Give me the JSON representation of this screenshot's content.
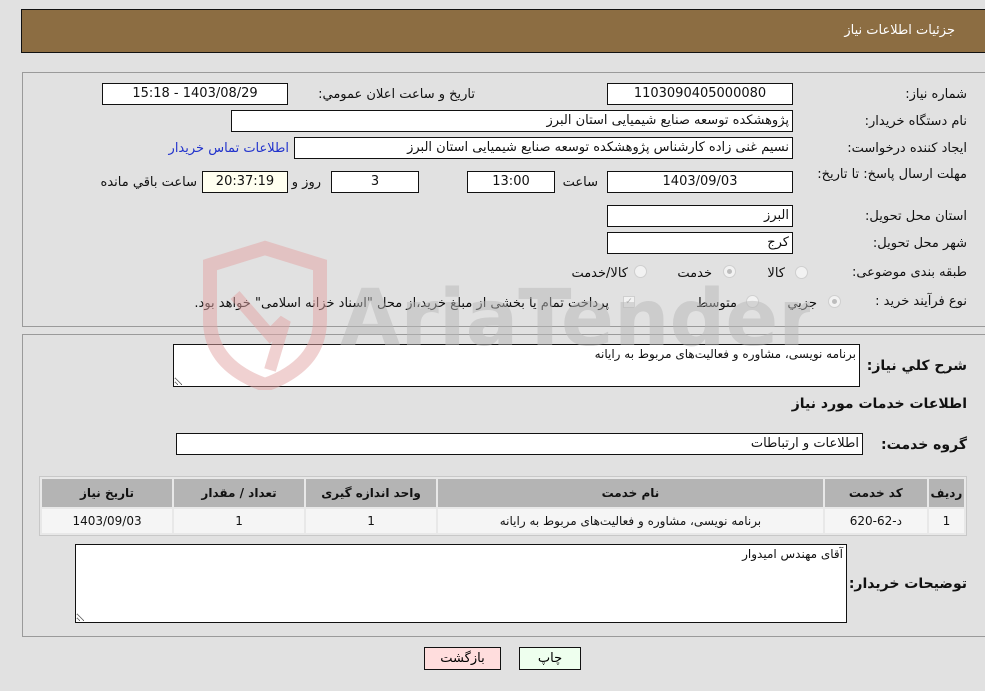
{
  "header": {
    "title": "جزئیات اطلاعات نیاز"
  },
  "form": {
    "need_number": {
      "label": "شماره نیاز:",
      "value": "1103090405000080"
    },
    "announce_datetime": {
      "label": "تاريخ و ساعت اعلان عمومي:",
      "value": "1403/08/29 - 15:18"
    },
    "buyer_org": {
      "label": "نام دستگاه خریدار:",
      "value": "پژوهشکده توسعه صنایع شیمیایی استان البرز"
    },
    "requester": {
      "label": "ایجاد کننده درخواست:",
      "value": "نسیم غنی زاده کارشناس پژوهشکده توسعه صنایع شیمیایی استان البرز"
    },
    "buyer_contact_link": "اطلاعات تماس خریدار",
    "deadline": {
      "label": "مهلت ارسال پاسخ: تا تاریخ:",
      "date": "1403/09/03",
      "time_label": "ساعت",
      "time": "13:00",
      "days": "3",
      "days_label": "روز و",
      "remaining": "20:37:19",
      "remaining_label": "ساعت باقي مانده"
    },
    "delivery_province": {
      "label": "استان محل تحویل:",
      "value": "البرز"
    },
    "delivery_city": {
      "label": "شهر محل تحویل:",
      "value": "کرج"
    },
    "category": {
      "label": "طبقه بندی موضوعی:",
      "options": [
        "کالا",
        "خدمت",
        "کالا/خدمت"
      ],
      "selected": "خدمت"
    },
    "purchase_type": {
      "label": "نوع فرآیند خرید :",
      "options": [
        "جزيي",
        "متوسط"
      ],
      "selected": "جزيي",
      "treasury_note": "پرداخت تمام یا بخشی از مبلغ خرید،از محل \"اسناد خزانه اسلامی\" خواهد بود."
    }
  },
  "details": {
    "description_label": "شرح كلي نياز:",
    "description": "برنامه نویسی، مشاوره و فعالیت‌های مربوط به رایانه",
    "services_heading": "اطلاعات خدمات مورد نیاز",
    "service_group_label": "گروه خدمت:",
    "service_group": "اطلاعات و ارتباطات",
    "table": {
      "headers": [
        "ردیف",
        "کد خدمت",
        "نام خدمت",
        "واحد اندازه گیری",
        "تعداد / مقدار",
        "تاریخ نیاز"
      ],
      "rows": [
        [
          "1",
          "د-62-620",
          "برنامه نویسی، مشاوره و فعالیت‌های مربوط به رایانه",
          "1",
          "1",
          "1403/09/03"
        ]
      ]
    },
    "buyer_notes_label": "توضیحات خریدار:",
    "buyer_notes": "آقای مهندس امیدوار"
  },
  "buttons": {
    "print": "چاپ",
    "back": "بازگشت"
  },
  "watermark": "AriaTender.neT",
  "colors": {
    "header": "#8c6d42",
    "print_bg": "#eeffee",
    "back_bg": "#ffdddd",
    "link": "#2233cc"
  }
}
